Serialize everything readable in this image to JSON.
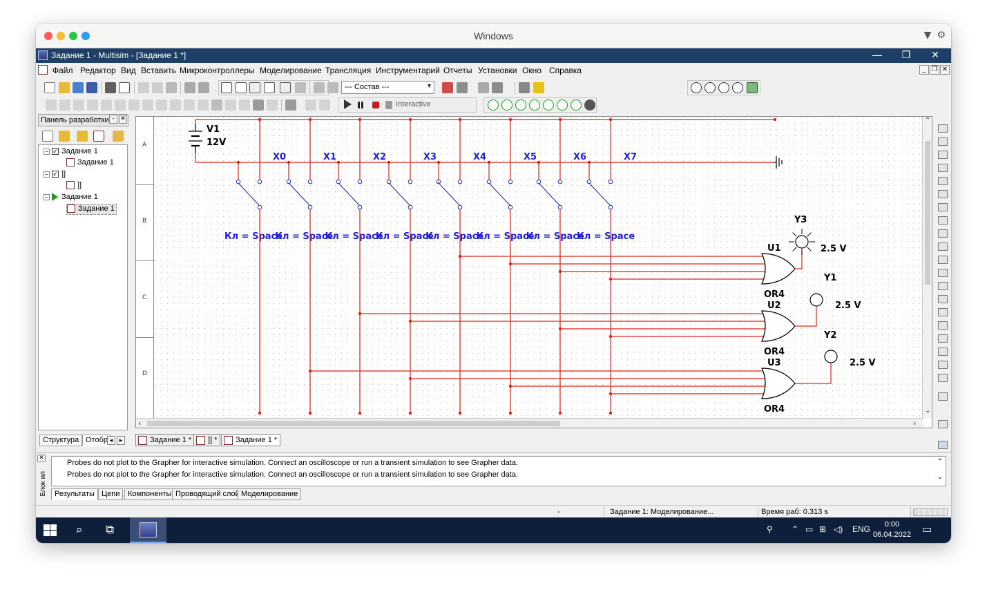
{
  "mac": {
    "title": "Windows",
    "traffic_colors": [
      "#fe5f57",
      "#febc2e",
      "#28c840",
      "#2a9df4"
    ]
  },
  "app": {
    "title": "Задание 1 - Multisim - [Задание 1 *]",
    "menus": [
      "Файл",
      "Редактор",
      "Вид",
      "Вставить",
      "Микроконтроллеры",
      "Моделирование",
      "Трансляция",
      "Инструментарий",
      "Отчеты",
      "Установки",
      "Окно",
      "Справка"
    ],
    "toolbar": {
      "assembly_combo": "--- Состав ---",
      "interactive_label": "Interactive"
    }
  },
  "design_panel": {
    "title": "Панель разработки",
    "tree": [
      {
        "label": "Задание 1",
        "level": 0,
        "kind": "checked"
      },
      {
        "label": "Задание 1",
        "level": 1,
        "kind": "file"
      },
      {
        "label": "]]",
        "level": 0,
        "kind": "checked"
      },
      {
        "label": "]]",
        "level": 1,
        "kind": "file"
      },
      {
        "label": "Задание 1",
        "level": 0,
        "kind": "active"
      },
      {
        "label": "Задание 1",
        "level": 1,
        "kind": "file-selected"
      }
    ],
    "tabs": [
      "Структура",
      "Отобр"
    ]
  },
  "schematic": {
    "zones": [
      "A",
      "B",
      "C",
      "D"
    ],
    "source": {
      "name": "V1",
      "value": "12V"
    },
    "switches": [
      "X0",
      "X1",
      "X2",
      "X3",
      "X4",
      "X5",
      "X6",
      "X7"
    ],
    "switch_keys": [
      "Кл = Space",
      "Кл = Space",
      "Кл = Space",
      "Кл = Space",
      "Кл = Space",
      "Кл = Space",
      "Кл = Space",
      "Кл = Space"
    ],
    "gates": [
      {
        "ref": "U1",
        "type": "OR4"
      },
      {
        "ref": "U2",
        "type": "OR4"
      },
      {
        "ref": "U3",
        "type": "OR4"
      }
    ],
    "probes": [
      {
        "ref": "Y3",
        "value": "2.5 V",
        "lit": true
      },
      {
        "ref": "Y2",
        "value": "2.5 V",
        "lit": false
      },
      {
        "ref": "Y1",
        "value": "2.5 V",
        "lit": false
      }
    ],
    "colors": {
      "wire": "#e0201c",
      "label": "#1f20d8",
      "component": "#000000",
      "switch": "#2030c0"
    }
  },
  "sheet_tabs": [
    "Задание 1 *",
    "]] *",
    "Задание 1 *"
  ],
  "spreadsheet": {
    "side_label": "Блок ил",
    "lines": [
      "Probes do not plot to the Grapher for interactive simulation. Connect an oscilloscope or run a transient simulation to see Grapher data.",
      "Probes do not plot to the Grapher for interactive simulation. Connect an oscilloscope or run a transient simulation to see Grapher data."
    ],
    "tabs": [
      "Результаты",
      "Цепи",
      "Компоненты",
      "Проводящий слой",
      "Моделирование"
    ]
  },
  "status": {
    "dash": "-",
    "sim_state": "Задание 1: Моделирование...",
    "time": "Время раб: 0.313 s"
  },
  "taskbar": {
    "lang": "ENG",
    "time": "0:00",
    "date": "06.04.2022"
  }
}
